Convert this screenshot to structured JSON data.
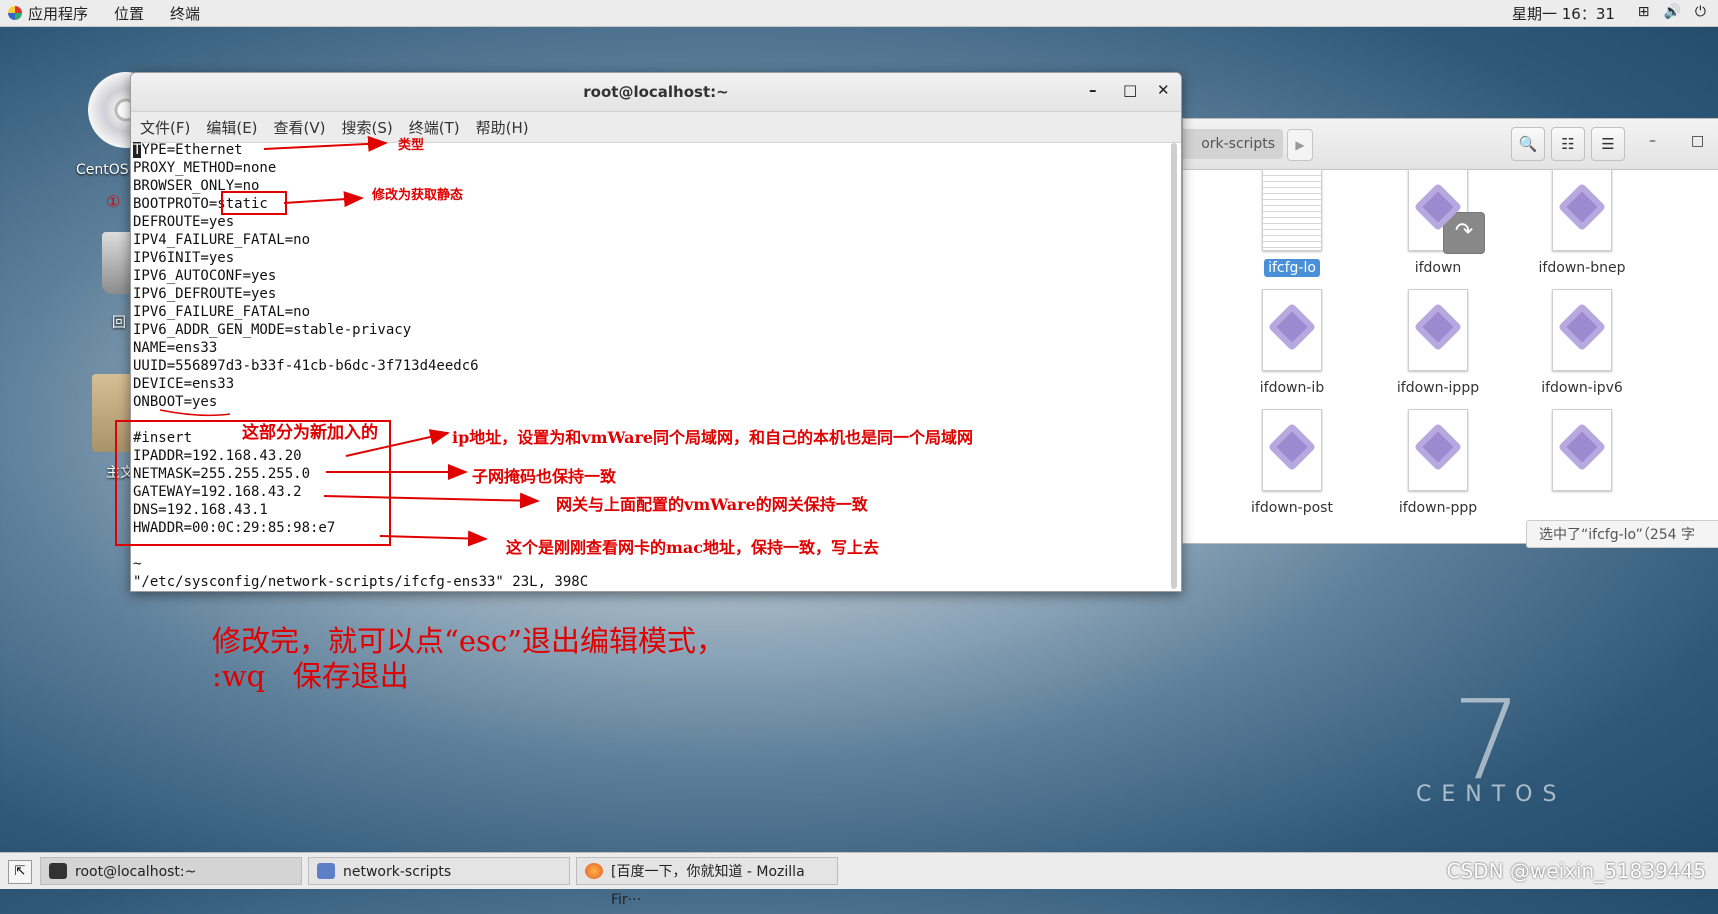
{
  "top_panel": {
    "menus": [
      "应用程序",
      "位置",
      "终端"
    ],
    "clock": "星期一 16：31",
    "tray_icons": [
      "network-icon",
      "volume-icon",
      "power-icon"
    ]
  },
  "desktop": {
    "icons": [
      "CentOS",
      "回",
      "主文"
    ],
    "logo_number": "7",
    "logo_word": "CENTOS"
  },
  "file_manager": {
    "path_label": "ork-scripts",
    "files": [
      {
        "name": "ifcfg-lo",
        "selected": true,
        "kind": "text"
      },
      {
        "name": "ifdown",
        "selected": false,
        "kind": "script-link"
      },
      {
        "name": "ifdown-bnep",
        "selected": false,
        "kind": "script"
      },
      {
        "name": "ifdown-ib",
        "selected": false,
        "kind": "script"
      },
      {
        "name": "ifdown-ippp",
        "selected": false,
        "kind": "script"
      },
      {
        "name": "ifdown-ipv6",
        "selected": false,
        "kind": "script"
      },
      {
        "name": "ifdown-post",
        "selected": false,
        "kind": "script"
      },
      {
        "name": "ifdown-ppp",
        "selected": false,
        "kind": "script"
      },
      {
        "name": "",
        "selected": false,
        "kind": "script"
      }
    ],
    "status": "选中了“ifcfg-lo”（254 字"
  },
  "terminal": {
    "title": "root@localhost:~",
    "menu": [
      "文件(F)",
      "编辑(E)",
      "查看(V)",
      "搜索(S)",
      "终端(T)",
      "帮助(H)"
    ],
    "lines": [
      "TYPE=Ethernet",
      "PROXY_METHOD=none",
      "BROWSER_ONLY=no",
      "BOOTPROTO=static",
      "DEFROUTE=yes",
      "IPV4_FAILURE_FATAL=no",
      "IPV6INIT=yes",
      "IPV6_AUTOCONF=yes",
      "IPV6_DEFROUTE=yes",
      "IPV6_FAILURE_FATAL=no",
      "IPV6_ADDR_GEN_MODE=stable-privacy",
      "NAME=ens33",
      "UUID=556897d3-b33f-41cb-b6dc-3f713d4eedc6",
      "DEVICE=ens33",
      "ONBOOT=yes",
      "",
      "#insert",
      "IPADDR=192.168.43.20",
      "NETMASK=255.255.255.0",
      "GATEWAY=192.168.43.2",
      "DNS=192.168.43.1",
      "HWADDR=00:0C:29:85:98:e7",
      "",
      "~",
      "\"/etc/sysconfig/network-scripts/ifcfg-ens33\" 23L, 398C"
    ]
  },
  "annotations": {
    "type": "类型",
    "circle_one": "①",
    "static": "修改为获取静态",
    "new_section": "这部分为新加入的",
    "ip": "ip地址，设置为和vmWare同个局域网，和自己的本机也是同一个局域网",
    "netmask": "子网掩码也保持一致",
    "gateway": "网关与上面配置的vmWare的网关保持一致",
    "mac": "这个是刚刚查看网卡的mac地址，保持一致，写上去",
    "footer_line1": "修改完，就可以点“esc”退出编辑模式，",
    "footer_line2": ":wq   保存退出"
  },
  "taskbar": {
    "items": [
      "root@localhost:~",
      "network-scripts",
      "[百度一下，你就知道 - Mozilla Fir···"
    ],
    "watermark": "CSDN @weixin_51839445"
  }
}
